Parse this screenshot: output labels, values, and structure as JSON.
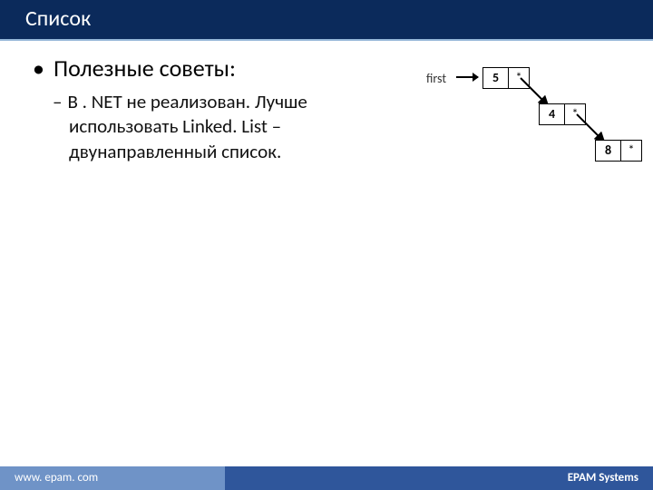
{
  "title": "Список",
  "main_bullet": "Полезные советы:",
  "sub_bullet": "В . NET не реализован. Лучше использовать Linked. List – двунаправленный список.",
  "diagram": {
    "first_label": "first",
    "nodes": [
      {
        "value": "5",
        "ptr": "*"
      },
      {
        "value": "4",
        "ptr": "*"
      },
      {
        "value": "8",
        "ptr": "*"
      }
    ]
  },
  "footer_left": "www. epam. com",
  "footer_right": "EPAM Systems"
}
